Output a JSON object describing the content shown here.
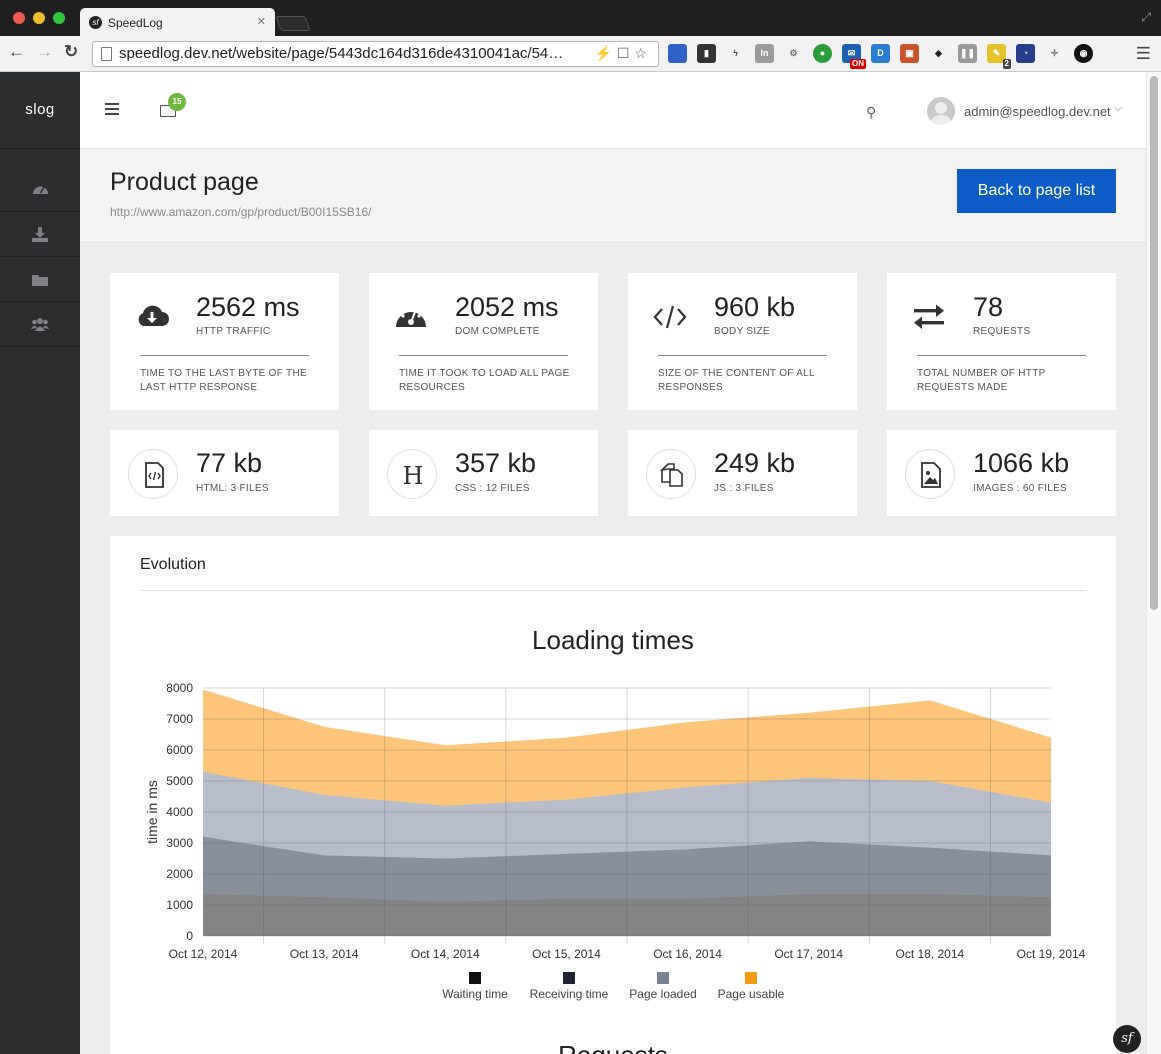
{
  "browser": {
    "tab_title": "SpeedLog",
    "url": "speedlog.dev.net/website/page/5443dc164d316de4310041ac/54…"
  },
  "app": {
    "brand": "slog",
    "mail_count": "15",
    "user_email": "admin@speedlog.dev.net"
  },
  "sidebar": {
    "items": [
      {
        "icon": "dashboard-icon"
      },
      {
        "icon": "download-icon"
      },
      {
        "icon": "folder-icon"
      },
      {
        "icon": "users-icon"
      }
    ]
  },
  "page": {
    "title": "Product page",
    "url": "http://www.amazon.com/gp/product/B00I15SB16/",
    "back_button": "Back to page list"
  },
  "stats": [
    {
      "icon": "cloud-download-icon",
      "value": "2562 ms",
      "label": "HTTP TRAFFIC",
      "description": "TIME TO THE LAST BYTE OF THE LAST HTTP RESPONSE"
    },
    {
      "icon": "speedometer-icon",
      "value": "2052 ms",
      "label": "DOM COMPLETE",
      "description": "TIME IT TOOK TO LOAD ALL PAGE RESOURCES"
    },
    {
      "icon": "code-icon",
      "value": "960 kb",
      "label": "BODY SIZE",
      "description": "SIZE OF THE CONTENT OF ALL RESPONSES"
    },
    {
      "icon": "exchange-icon",
      "value": "78",
      "label": "REQUESTS",
      "description": "TOTAL NUMBER OF HTTP REQUESTS MADE"
    }
  ],
  "files": [
    {
      "icon": "html-file-icon",
      "value": "77 kb",
      "label": "HTML: 3 FILES"
    },
    {
      "icon": "css-h-icon",
      "value": "357 kb",
      "label": "CSS : 12 FILES"
    },
    {
      "icon": "js-files-icon",
      "value": "249 kb",
      "label": "JS : 3 FILES"
    },
    {
      "icon": "image-file-icon",
      "value": "1066 kb",
      "label": "IMAGES : 60 FILES"
    }
  ],
  "evolution": {
    "title": "Evolution",
    "next_title": "Requests"
  },
  "chart_data": {
    "type": "area",
    "title": "Loading times",
    "xlabel": "",
    "ylabel": "time in ms",
    "ylim": [
      0,
      8000
    ],
    "yticks": [
      0,
      1000,
      2000,
      3000,
      4000,
      5000,
      6000,
      7000,
      8000
    ],
    "categories": [
      "Oct 12, 2014",
      "Oct 13, 2014",
      "Oct 14, 2014",
      "Oct 15, 2014",
      "Oct 16, 2014",
      "Oct 17, 2014",
      "Oct 18, 2014",
      "Oct 19, 2014"
    ],
    "series": [
      {
        "name": "Waiting time",
        "color": "#111111",
        "fill": "#848484",
        "values": [
          1350,
          1250,
          1100,
          1200,
          1200,
          1350,
          1350,
          1250
        ]
      },
      {
        "name": "Receiving time",
        "color": "#1f2434",
        "fill": "#8a8f9c",
        "values": [
          3200,
          2600,
          2500,
          2650,
          2800,
          3050,
          2850,
          2600
        ]
      },
      {
        "name": "Page loaded",
        "color": "#7a8293",
        "fill": "#b8bdcb",
        "values": [
          5300,
          4550,
          4200,
          4400,
          4800,
          5100,
          5000,
          4300
        ]
      },
      {
        "name": "Page usable",
        "color": "#f39c12",
        "fill": "#fcc57a",
        "values": [
          7950,
          6750,
          6150,
          6400,
          6900,
          7200,
          7600,
          6400
        ]
      }
    ],
    "grid": true,
    "legend_position": "bottom"
  }
}
